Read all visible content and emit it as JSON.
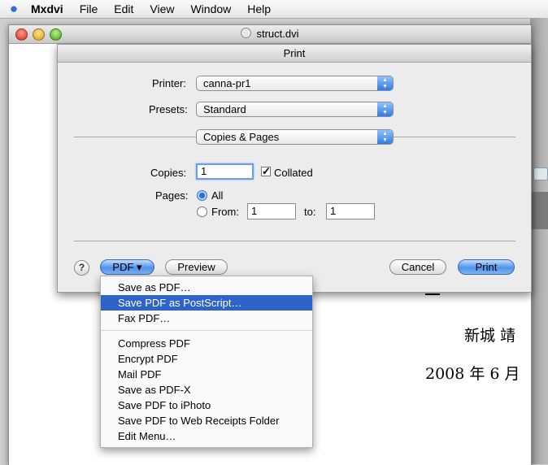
{
  "menubar": {
    "app_name": "Mxdvi",
    "items": [
      "File",
      "Edit",
      "View",
      "Window",
      "Help"
    ]
  },
  "document": {
    "title": "struct.dvi",
    "text_line1": "新城 靖",
    "text_line2": "2008 年 6 月"
  },
  "print_dialog": {
    "title": "Print",
    "printer_label": "Printer:",
    "printer_value": "canna-pr1",
    "presets_label": "Presets:",
    "presets_value": "Standard",
    "pane_value": "Copies & Pages",
    "copies_label": "Copies:",
    "copies_value": "1",
    "collated_label": "Collated",
    "collated_checked": true,
    "pages_label": "Pages:",
    "all_label": "All",
    "from_label": "From:",
    "from_value": "1",
    "to_label": "to:",
    "to_value": "1",
    "help_label": "?",
    "pdf_button": "PDF ▾",
    "preview_button": "Preview",
    "cancel_button": "Cancel",
    "print_button": "Print"
  },
  "pdf_menu": {
    "items": [
      "Save as PDF…",
      "Save PDF as PostScript…",
      "Fax PDF…",
      "Compress PDF",
      "Encrypt PDF",
      "Mail PDF",
      "Save as PDF-X",
      "Save PDF to iPhoto",
      "Save PDF to Web Receipts Folder",
      "Edit Menu…"
    ],
    "highlighted_index": 1
  },
  "colors": {
    "accent": "#2e64c8",
    "button_blue": "#4f92ea"
  }
}
